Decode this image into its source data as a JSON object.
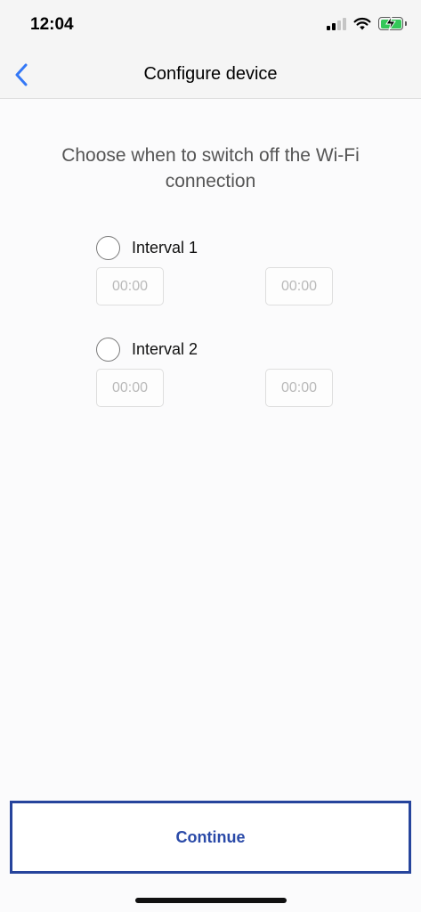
{
  "status_bar": {
    "time": "12:04",
    "icons": [
      "cellular-signal-icon",
      "wifi-icon",
      "battery-charging-icon"
    ],
    "battery_color": "#34c759"
  },
  "nav": {
    "title": "Configure device",
    "back_icon": "chevron-left-icon",
    "accent": "#3478f6"
  },
  "main": {
    "prompt": "Choose when to switch off the Wi-Fi connection",
    "intervals": [
      {
        "label": "Interval 1",
        "selected": false,
        "start": "00:00",
        "end": "00:00"
      },
      {
        "label": "Interval 2",
        "selected": false,
        "start": "00:00",
        "end": "00:00"
      }
    ]
  },
  "footer": {
    "continue_label": "Continue",
    "button_color": "#26449c"
  }
}
